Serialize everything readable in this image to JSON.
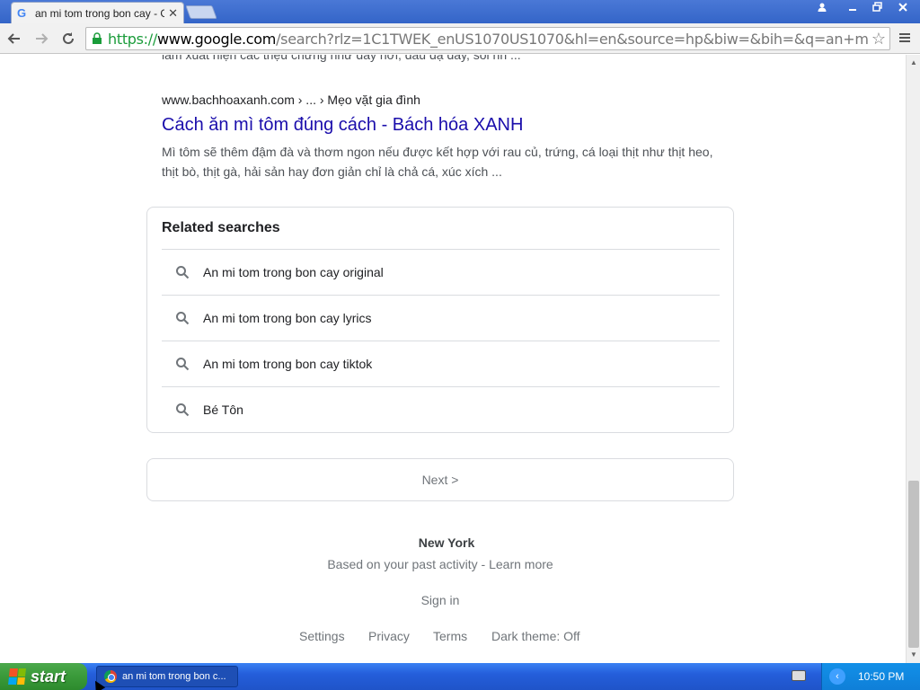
{
  "browser": {
    "tab_title": "an mi tom trong bon cay - Go",
    "tab_close": "✕",
    "url_scheme": "https://",
    "url_host": "www.google.com",
    "url_rest": "/search?rlz=1C1TWEK_enUS1070US1070&hl=en&source=hp&biw=&bih=&q=an+mi+tom+trong"
  },
  "result": {
    "cutoff_text": "làm xuất hiện các triệu chứng như đầy hơi, đau dạ dày, sôi nh ...",
    "cite": "www.bachhoaxanh.com › ... › Mẹo vặt gia đình",
    "title": "Cách ăn mì tôm đúng cách - Bách hóa XANH",
    "snippet": "Mì tôm sẽ thêm đậm đà và thơm ngon nếu được kết hợp với rau củ, trứng, cá loại thịt như thịt heo, thịt bò, thịt gà, hải sản hay đơn giản chỉ là chả cá, xúc xích ..."
  },
  "related": {
    "title": "Related searches",
    "items": [
      "An mi tom trong bon cay original",
      "An mi tom trong bon cay lyrics",
      "An mi tom trong bon cay tiktok",
      "Bé Tôn"
    ]
  },
  "pagination": {
    "next": "Next >"
  },
  "footer": {
    "location": "New York",
    "location_note": "Based on your past activity - Learn more",
    "sign_in": "Sign in",
    "links": [
      "Settings",
      "Privacy",
      "Terms",
      "Dark theme: Off"
    ]
  },
  "taskbar": {
    "start": "start",
    "task_item": "an mi tom trong bon c...",
    "clock": "10:50 PM"
  },
  "colors": {
    "link_title": "#1a0dab",
    "secure_green": "#1a9c3a",
    "xp_blue": "#245edb",
    "start_green": "#3a9a3a"
  }
}
